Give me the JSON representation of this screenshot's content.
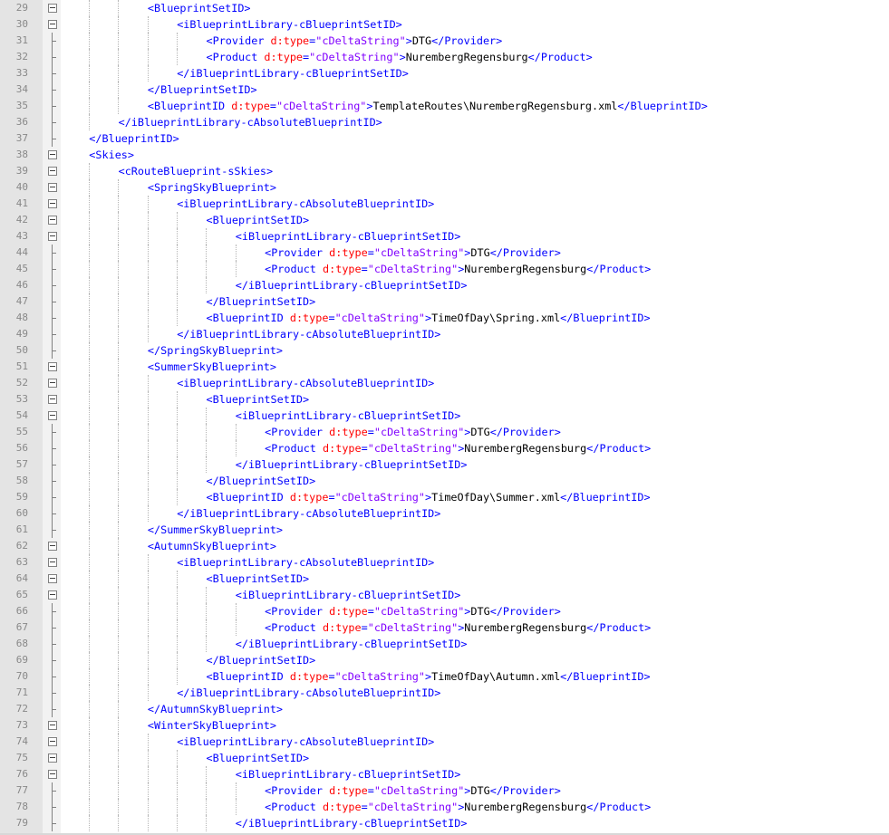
{
  "colors": {
    "tag": "#0000ff",
    "attribute": "#ff0000",
    "value": "#8000ff",
    "text": "#000000",
    "gutter": "#e4e4e4",
    "line_number": "#888888"
  },
  "lines": [
    {
      "n": "29",
      "indent": 2,
      "fold": "box",
      "tokens": [
        {
          "t": "tag",
          "v": "<BlueprintSetID>"
        }
      ]
    },
    {
      "n": "30",
      "indent": 3,
      "fold": "box",
      "tokens": [
        {
          "t": "tag",
          "v": "<iBlueprintLibrary-cBlueprintSetID>"
        }
      ]
    },
    {
      "n": "31",
      "indent": 4,
      "fold": "tick",
      "tokens": [
        {
          "t": "tag",
          "v": "<Provider "
        },
        {
          "t": "attr",
          "v": "d:type"
        },
        {
          "t": "tag",
          "v": "="
        },
        {
          "t": "str",
          "v": "\"cDeltaString\""
        },
        {
          "t": "tag",
          "v": ">"
        },
        {
          "t": "txt",
          "v": "DTG"
        },
        {
          "t": "tag",
          "v": "</Provider>"
        }
      ]
    },
    {
      "n": "32",
      "indent": 4,
      "fold": "tick",
      "tokens": [
        {
          "t": "tag",
          "v": "<Product "
        },
        {
          "t": "attr",
          "v": "d:type"
        },
        {
          "t": "tag",
          "v": "="
        },
        {
          "t": "str",
          "v": "\"cDeltaString\""
        },
        {
          "t": "tag",
          "v": ">"
        },
        {
          "t": "txt",
          "v": "NurembergRegensburg"
        },
        {
          "t": "tag",
          "v": "</Product>"
        }
      ]
    },
    {
      "n": "33",
      "indent": 3,
      "fold": "tick",
      "tokens": [
        {
          "t": "tag",
          "v": "</iBlueprintLibrary-cBlueprintSetID>"
        }
      ]
    },
    {
      "n": "34",
      "indent": 2,
      "fold": "tick",
      "tokens": [
        {
          "t": "tag",
          "v": "</BlueprintSetID>"
        }
      ]
    },
    {
      "n": "35",
      "indent": 2,
      "fold": "tick",
      "tokens": [
        {
          "t": "tag",
          "v": "<BlueprintID "
        },
        {
          "t": "attr",
          "v": "d:type"
        },
        {
          "t": "tag",
          "v": "="
        },
        {
          "t": "str",
          "v": "\"cDeltaString\""
        },
        {
          "t": "tag",
          "v": ">"
        },
        {
          "t": "txt",
          "v": "TemplateRoutes\\NurembergRegensburg.xml"
        },
        {
          "t": "tag",
          "v": "</BlueprintID>"
        }
      ]
    },
    {
      "n": "36",
      "indent": 1,
      "fold": "tick",
      "tokens": [
        {
          "t": "tag",
          "v": "</iBlueprintLibrary-cAbsoluteBlueprintID>"
        }
      ]
    },
    {
      "n": "37",
      "indent": 0,
      "fold": "tick",
      "tokens": [
        {
          "t": "tag",
          "v": "</BlueprintID>"
        }
      ]
    },
    {
      "n": "38",
      "indent": 0,
      "fold": "box",
      "tokens": [
        {
          "t": "tag",
          "v": "<Skies>"
        }
      ]
    },
    {
      "n": "39",
      "indent": 1,
      "fold": "box",
      "tokens": [
        {
          "t": "tag",
          "v": "<cRouteBlueprint-sSkies>"
        }
      ]
    },
    {
      "n": "40",
      "indent": 2,
      "fold": "box",
      "tokens": [
        {
          "t": "tag",
          "v": "<SpringSkyBlueprint>"
        }
      ]
    },
    {
      "n": "41",
      "indent": 3,
      "fold": "box",
      "tokens": [
        {
          "t": "tag",
          "v": "<iBlueprintLibrary-cAbsoluteBlueprintID>"
        }
      ]
    },
    {
      "n": "42",
      "indent": 4,
      "fold": "box",
      "tokens": [
        {
          "t": "tag",
          "v": "<BlueprintSetID>"
        }
      ]
    },
    {
      "n": "43",
      "indent": 5,
      "fold": "box",
      "tokens": [
        {
          "t": "tag",
          "v": "<iBlueprintLibrary-cBlueprintSetID>"
        }
      ]
    },
    {
      "n": "44",
      "indent": 6,
      "fold": "tick",
      "tokens": [
        {
          "t": "tag",
          "v": "<Provider "
        },
        {
          "t": "attr",
          "v": "d:type"
        },
        {
          "t": "tag",
          "v": "="
        },
        {
          "t": "str",
          "v": "\"cDeltaString\""
        },
        {
          "t": "tag",
          "v": ">"
        },
        {
          "t": "txt",
          "v": "DTG"
        },
        {
          "t": "tag",
          "v": "</Provider>"
        }
      ]
    },
    {
      "n": "45",
      "indent": 6,
      "fold": "tick",
      "tokens": [
        {
          "t": "tag",
          "v": "<Product "
        },
        {
          "t": "attr",
          "v": "d:type"
        },
        {
          "t": "tag",
          "v": "="
        },
        {
          "t": "str",
          "v": "\"cDeltaString\""
        },
        {
          "t": "tag",
          "v": ">"
        },
        {
          "t": "txt",
          "v": "NurembergRegensburg"
        },
        {
          "t": "tag",
          "v": "</Product>"
        }
      ]
    },
    {
      "n": "46",
      "indent": 5,
      "fold": "tick",
      "tokens": [
        {
          "t": "tag",
          "v": "</iBlueprintLibrary-cBlueprintSetID>"
        }
      ]
    },
    {
      "n": "47",
      "indent": 4,
      "fold": "tick",
      "tokens": [
        {
          "t": "tag",
          "v": "</BlueprintSetID>"
        }
      ]
    },
    {
      "n": "48",
      "indent": 4,
      "fold": "tick",
      "tokens": [
        {
          "t": "tag",
          "v": "<BlueprintID "
        },
        {
          "t": "attr",
          "v": "d:type"
        },
        {
          "t": "tag",
          "v": "="
        },
        {
          "t": "str",
          "v": "\"cDeltaString\""
        },
        {
          "t": "tag",
          "v": ">"
        },
        {
          "t": "txt",
          "v": "TimeOfDay\\Spring.xml"
        },
        {
          "t": "tag",
          "v": "</BlueprintID>"
        }
      ]
    },
    {
      "n": "49",
      "indent": 3,
      "fold": "tick",
      "tokens": [
        {
          "t": "tag",
          "v": "</iBlueprintLibrary-cAbsoluteBlueprintID>"
        }
      ]
    },
    {
      "n": "50",
      "indent": 2,
      "fold": "tick",
      "tokens": [
        {
          "t": "tag",
          "v": "</SpringSkyBlueprint>"
        }
      ]
    },
    {
      "n": "51",
      "indent": 2,
      "fold": "box",
      "tokens": [
        {
          "t": "tag",
          "v": "<SummerSkyBlueprint>"
        }
      ]
    },
    {
      "n": "52",
      "indent": 3,
      "fold": "box",
      "tokens": [
        {
          "t": "tag",
          "v": "<iBlueprintLibrary-cAbsoluteBlueprintID>"
        }
      ]
    },
    {
      "n": "53",
      "indent": 4,
      "fold": "box",
      "tokens": [
        {
          "t": "tag",
          "v": "<BlueprintSetID>"
        }
      ]
    },
    {
      "n": "54",
      "indent": 5,
      "fold": "box",
      "tokens": [
        {
          "t": "tag",
          "v": "<iBlueprintLibrary-cBlueprintSetID>"
        }
      ]
    },
    {
      "n": "55",
      "indent": 6,
      "fold": "tick",
      "tokens": [
        {
          "t": "tag",
          "v": "<Provider "
        },
        {
          "t": "attr",
          "v": "d:type"
        },
        {
          "t": "tag",
          "v": "="
        },
        {
          "t": "str",
          "v": "\"cDeltaString\""
        },
        {
          "t": "tag",
          "v": ">"
        },
        {
          "t": "txt",
          "v": "DTG"
        },
        {
          "t": "tag",
          "v": "</Provider>"
        }
      ]
    },
    {
      "n": "56",
      "indent": 6,
      "fold": "tick",
      "tokens": [
        {
          "t": "tag",
          "v": "<Product "
        },
        {
          "t": "attr",
          "v": "d:type"
        },
        {
          "t": "tag",
          "v": "="
        },
        {
          "t": "str",
          "v": "\"cDeltaString\""
        },
        {
          "t": "tag",
          "v": ">"
        },
        {
          "t": "txt",
          "v": "NurembergRegensburg"
        },
        {
          "t": "tag",
          "v": "</Product>"
        }
      ]
    },
    {
      "n": "57",
      "indent": 5,
      "fold": "tick",
      "tokens": [
        {
          "t": "tag",
          "v": "</iBlueprintLibrary-cBlueprintSetID>"
        }
      ]
    },
    {
      "n": "58",
      "indent": 4,
      "fold": "tick",
      "tokens": [
        {
          "t": "tag",
          "v": "</BlueprintSetID>"
        }
      ]
    },
    {
      "n": "59",
      "indent": 4,
      "fold": "tick",
      "tokens": [
        {
          "t": "tag",
          "v": "<BlueprintID "
        },
        {
          "t": "attr",
          "v": "d:type"
        },
        {
          "t": "tag",
          "v": "="
        },
        {
          "t": "str",
          "v": "\"cDeltaString\""
        },
        {
          "t": "tag",
          "v": ">"
        },
        {
          "t": "txt",
          "v": "TimeOfDay\\Summer.xml"
        },
        {
          "t": "tag",
          "v": "</BlueprintID>"
        }
      ]
    },
    {
      "n": "60",
      "indent": 3,
      "fold": "tick",
      "tokens": [
        {
          "t": "tag",
          "v": "</iBlueprintLibrary-cAbsoluteBlueprintID>"
        }
      ]
    },
    {
      "n": "61",
      "indent": 2,
      "fold": "tick",
      "tokens": [
        {
          "t": "tag",
          "v": "</SummerSkyBlueprint>"
        }
      ]
    },
    {
      "n": "62",
      "indent": 2,
      "fold": "box",
      "tokens": [
        {
          "t": "tag",
          "v": "<AutumnSkyBlueprint>"
        }
      ]
    },
    {
      "n": "63",
      "indent": 3,
      "fold": "box",
      "tokens": [
        {
          "t": "tag",
          "v": "<iBlueprintLibrary-cAbsoluteBlueprintID>"
        }
      ]
    },
    {
      "n": "64",
      "indent": 4,
      "fold": "box",
      "tokens": [
        {
          "t": "tag",
          "v": "<BlueprintSetID>"
        }
      ]
    },
    {
      "n": "65",
      "indent": 5,
      "fold": "box",
      "tokens": [
        {
          "t": "tag",
          "v": "<iBlueprintLibrary-cBlueprintSetID>"
        }
      ]
    },
    {
      "n": "66",
      "indent": 6,
      "fold": "tick",
      "tokens": [
        {
          "t": "tag",
          "v": "<Provider "
        },
        {
          "t": "attr",
          "v": "d:type"
        },
        {
          "t": "tag",
          "v": "="
        },
        {
          "t": "str",
          "v": "\"cDeltaString\""
        },
        {
          "t": "tag",
          "v": ">"
        },
        {
          "t": "txt",
          "v": "DTG"
        },
        {
          "t": "tag",
          "v": "</Provider>"
        }
      ]
    },
    {
      "n": "67",
      "indent": 6,
      "fold": "tick",
      "tokens": [
        {
          "t": "tag",
          "v": "<Product "
        },
        {
          "t": "attr",
          "v": "d:type"
        },
        {
          "t": "tag",
          "v": "="
        },
        {
          "t": "str",
          "v": "\"cDeltaString\""
        },
        {
          "t": "tag",
          "v": ">"
        },
        {
          "t": "txt",
          "v": "NurembergRegensburg"
        },
        {
          "t": "tag",
          "v": "</Product>"
        }
      ]
    },
    {
      "n": "68",
      "indent": 5,
      "fold": "tick",
      "tokens": [
        {
          "t": "tag",
          "v": "</iBlueprintLibrary-cBlueprintSetID>"
        }
      ]
    },
    {
      "n": "69",
      "indent": 4,
      "fold": "tick",
      "tokens": [
        {
          "t": "tag",
          "v": "</BlueprintSetID>"
        }
      ]
    },
    {
      "n": "70",
      "indent": 4,
      "fold": "tick",
      "tokens": [
        {
          "t": "tag",
          "v": "<BlueprintID "
        },
        {
          "t": "attr",
          "v": "d:type"
        },
        {
          "t": "tag",
          "v": "="
        },
        {
          "t": "str",
          "v": "\"cDeltaString\""
        },
        {
          "t": "tag",
          "v": ">"
        },
        {
          "t": "txt",
          "v": "TimeOfDay\\Autumn.xml"
        },
        {
          "t": "tag",
          "v": "</BlueprintID>"
        }
      ]
    },
    {
      "n": "71",
      "indent": 3,
      "fold": "tick",
      "tokens": [
        {
          "t": "tag",
          "v": "</iBlueprintLibrary-cAbsoluteBlueprintID>"
        }
      ]
    },
    {
      "n": "72",
      "indent": 2,
      "fold": "tick",
      "tokens": [
        {
          "t": "tag",
          "v": "</AutumnSkyBlueprint>"
        }
      ]
    },
    {
      "n": "73",
      "indent": 2,
      "fold": "box",
      "tokens": [
        {
          "t": "tag",
          "v": "<WinterSkyBlueprint>"
        }
      ]
    },
    {
      "n": "74",
      "indent": 3,
      "fold": "box",
      "tokens": [
        {
          "t": "tag",
          "v": "<iBlueprintLibrary-cAbsoluteBlueprintID>"
        }
      ]
    },
    {
      "n": "75",
      "indent": 4,
      "fold": "box",
      "tokens": [
        {
          "t": "tag",
          "v": "<BlueprintSetID>"
        }
      ]
    },
    {
      "n": "76",
      "indent": 5,
      "fold": "box",
      "tokens": [
        {
          "t": "tag",
          "v": "<iBlueprintLibrary-cBlueprintSetID>"
        }
      ]
    },
    {
      "n": "77",
      "indent": 6,
      "fold": "tick",
      "tokens": [
        {
          "t": "tag",
          "v": "<Provider "
        },
        {
          "t": "attr",
          "v": "d:type"
        },
        {
          "t": "tag",
          "v": "="
        },
        {
          "t": "str",
          "v": "\"cDeltaString\""
        },
        {
          "t": "tag",
          "v": ">"
        },
        {
          "t": "txt",
          "v": "DTG"
        },
        {
          "t": "tag",
          "v": "</Provider>"
        }
      ]
    },
    {
      "n": "78",
      "indent": 6,
      "fold": "tick",
      "tokens": [
        {
          "t": "tag",
          "v": "<Product "
        },
        {
          "t": "attr",
          "v": "d:type"
        },
        {
          "t": "tag",
          "v": "="
        },
        {
          "t": "str",
          "v": "\"cDeltaString\""
        },
        {
          "t": "tag",
          "v": ">"
        },
        {
          "t": "txt",
          "v": "NurembergRegensburg"
        },
        {
          "t": "tag",
          "v": "</Product>"
        }
      ]
    },
    {
      "n": "79",
      "indent": 5,
      "fold": "tick",
      "tokens": [
        {
          "t": "tag",
          "v": "</iBlueprintLibrary-cBlueprintSetID>"
        }
      ]
    }
  ]
}
